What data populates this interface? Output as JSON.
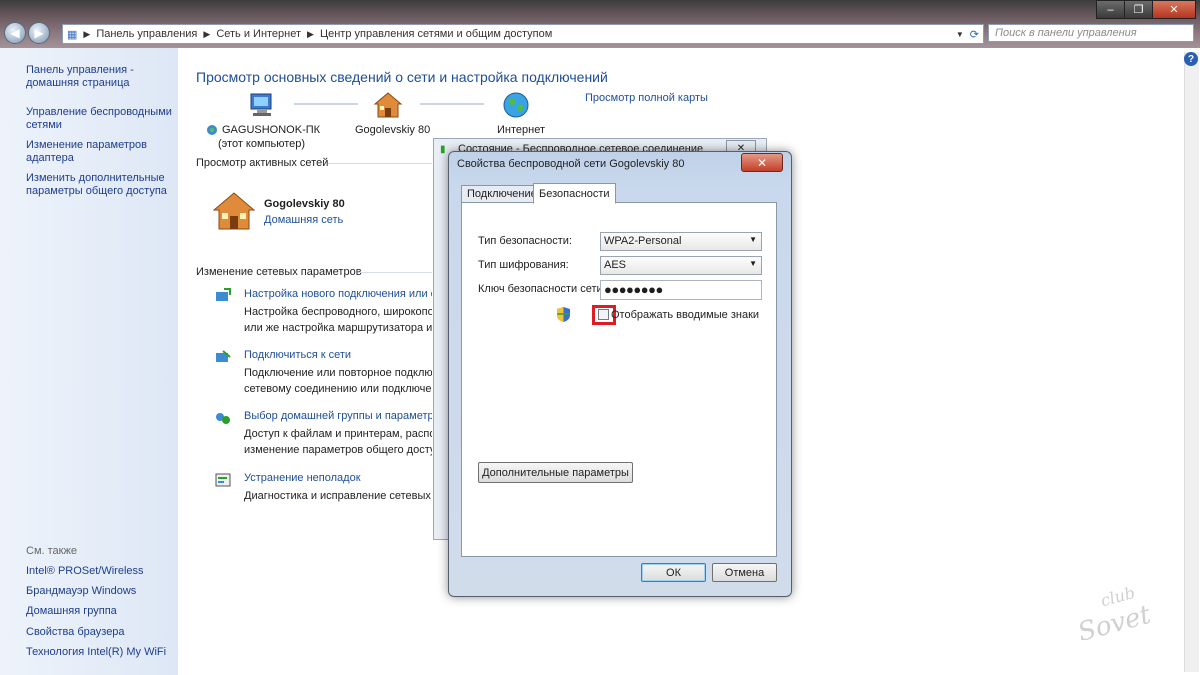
{
  "window": {
    "controls": [
      "–",
      "❐",
      "✕"
    ]
  },
  "address_bar": {
    "crumbs": [
      "Панель управления",
      "Сеть и Интернет",
      "Центр управления сетями и общим доступом"
    ]
  },
  "search": {
    "placeholder": "Поиск в панели управления"
  },
  "sidebar": {
    "links": [
      "Панель управления - домашняя страница",
      "Управление беспроводными сетями",
      "Изменение параметров адаптера",
      "Изменить дополнительные параметры общего доступа"
    ],
    "see_also_label": "См. также",
    "see_also": [
      "Intel® PROSet/Wireless",
      "Брандмауэр Windows",
      "Домашняя группа",
      "Свойства браузера",
      "Технология Intel(R) My WiFi"
    ]
  },
  "main": {
    "title": "Просмотр основных сведений о сети и настройка подключений",
    "full_map_link": "Просмотр полной карты",
    "map": {
      "computer_name": "GAGUSHONOK-ПК",
      "computer_sub": "(этот компьютер)",
      "network_name": "Gogolevskiy 80",
      "internet": "Интернет"
    },
    "active_networks_label": "Просмотр активных сетей",
    "active_network": {
      "name": "Gogolevskiy 80",
      "type": "Домашняя сеть"
    },
    "change_settings_label": "Изменение сетевых параметров",
    "tasks": [
      {
        "link": "Настройка нового подключения или се",
        "desc": [
          "Настройка беспроводного, широкопол",
          "или же настройка маршрутизатора или"
        ]
      },
      {
        "link": "Подключиться к сети",
        "desc": [
          "Подключение или повторное подключ",
          "сетевому соединению или подключен"
        ]
      },
      {
        "link": "Выбор домашней группы и параметро",
        "desc": [
          "Доступ к файлам и принтерам, распол",
          "изменение параметров общего доступ"
        ]
      },
      {
        "link": "Устранение неполадок",
        "desc": [
          "Диагностика и исправление сетевых пр"
        ]
      }
    ]
  },
  "status_dialog": {
    "title": "Состояние - Беспроводное сетевое соединение"
  },
  "dialog": {
    "title": "Свойства беспроводной сети Gogolevskiy 80",
    "close": "✕",
    "tabs": [
      "Подключение",
      "Безопасности"
    ],
    "security_type_label": "Тип безопасности:",
    "security_type_value": "WPA2-Personal",
    "encryption_label": "Тип шифрования:",
    "encryption_value": "AES",
    "key_label": "Ключ безопасности сети",
    "key_value": "●●●●●●●●",
    "show_chars_label": "Отображать вводимые знаки",
    "show_chars_checked": false,
    "advanced_button": "Дополнительные параметры",
    "ok": "ОК",
    "cancel": "Отмена"
  },
  "help_icon": "?",
  "watermark": "club Sovet"
}
